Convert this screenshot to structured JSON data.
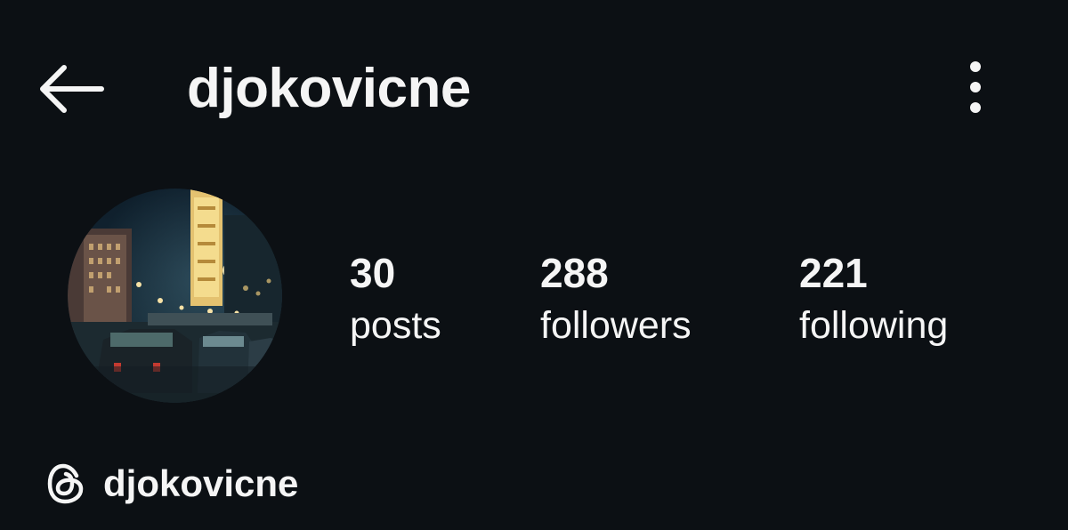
{
  "header": {
    "back_icon": "arrow-left-icon",
    "username": "djokovicne",
    "more_icon": "more-vertical-icon"
  },
  "profile": {
    "avatar": "profile-photo-city-night-street"
  },
  "stats": [
    {
      "value": "30",
      "label": "posts"
    },
    {
      "value": "288",
      "label": "followers"
    },
    {
      "value": "221",
      "label": "following"
    }
  ],
  "threads": {
    "icon": "threads-icon",
    "handle": "djokovicne"
  },
  "colors": {
    "background": "#0c1014",
    "text": "#f5f5f5"
  }
}
